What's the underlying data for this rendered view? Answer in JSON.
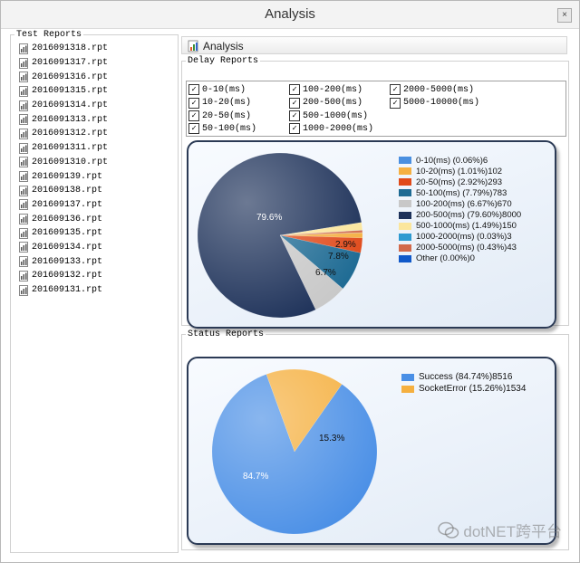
{
  "window": {
    "title": "Analysis",
    "close_label": "×"
  },
  "test_reports": {
    "legend": "Test Reports",
    "files": [
      "2016091318.rpt",
      "2016091317.rpt",
      "2016091316.rpt",
      "2016091315.rpt",
      "2016091314.rpt",
      "2016091313.rpt",
      "2016091312.rpt",
      "2016091311.rpt",
      "2016091310.rpt",
      "201609139.rpt",
      "201609138.rpt",
      "201609137.rpt",
      "201609136.rpt",
      "201609135.rpt",
      "201609134.rpt",
      "201609133.rpt",
      "201609132.rpt",
      "201609131.rpt"
    ]
  },
  "tab": {
    "label": "Analysis"
  },
  "delay_reports": {
    "legend": "Delay  Reports",
    "checkboxes": [
      {
        "label": "0-10(ms)",
        "checked": true
      },
      {
        "label": "10-20(ms)",
        "checked": true
      },
      {
        "label": "20-50(ms)",
        "checked": true
      },
      {
        "label": "50-100(ms)",
        "checked": true
      },
      {
        "label": "100-200(ms)",
        "checked": true
      },
      {
        "label": "200-500(ms)",
        "checked": true
      },
      {
        "label": "500-1000(ms)",
        "checked": true
      },
      {
        "label": "1000-2000(ms)",
        "checked": true
      },
      {
        "label": "2000-5000(ms)",
        "checked": true
      },
      {
        "label": "5000-10000(ms)",
        "checked": true
      }
    ]
  },
  "status_reports": {
    "legend": "Status Reports"
  },
  "watermark": {
    "text": "dotNET跨平台"
  },
  "chart_data": [
    {
      "type": "pie",
      "name": "delay",
      "slices": [
        {
          "label": "0-10(ms) (0.06%)6",
          "value": 6,
          "percent": 0.06,
          "color": "#4a8fe0"
        },
        {
          "label": "10-20(ms) (1.01%)102",
          "value": 102,
          "percent": 1.01,
          "color": "#f5b042"
        },
        {
          "label": "20-50(ms) (2.92%)293",
          "value": 293,
          "percent": 2.92,
          "color": "#e04a1a"
        },
        {
          "label": "50-100(ms) (7.79%)783",
          "value": 783,
          "percent": 7.79,
          "color": "#1d6a93"
        },
        {
          "label": "100-200(ms) (6.67%)670",
          "value": 670,
          "percent": 6.67,
          "color": "#c8c8c8"
        },
        {
          "label": "200-500(ms) (79.60%)8000",
          "value": 8000,
          "percent": 79.6,
          "color": "#1d3159"
        },
        {
          "label": "500-1000(ms) (1.49%)150",
          "value": 150,
          "percent": 1.49,
          "color": "#fbe69c"
        },
        {
          "label": "1000-2000(ms) (0.03%)3",
          "value": 3,
          "percent": 0.03,
          "color": "#2d9ad0"
        },
        {
          "label": "2000-5000(ms) (0.43%)43",
          "value": 43,
          "percent": 0.43,
          "color": "#d2694a"
        },
        {
          "label": "Other (0.00%)0",
          "value": 0,
          "percent": 0,
          "color": "#1159c9"
        }
      ],
      "data_labels": [
        "79.6%",
        "2.9%",
        "7.8%",
        "6.7%"
      ]
    },
    {
      "type": "pie",
      "name": "status",
      "slices": [
        {
          "label": "Success (84.74%)8516",
          "value": 8516,
          "percent": 84.74,
          "color": "#4a8fe6"
        },
        {
          "label": "SocketError (15.26%)1534",
          "value": 1534,
          "percent": 15.26,
          "color": "#f5b040"
        }
      ],
      "data_labels": [
        "84.7%",
        "15.3%"
      ]
    }
  ]
}
